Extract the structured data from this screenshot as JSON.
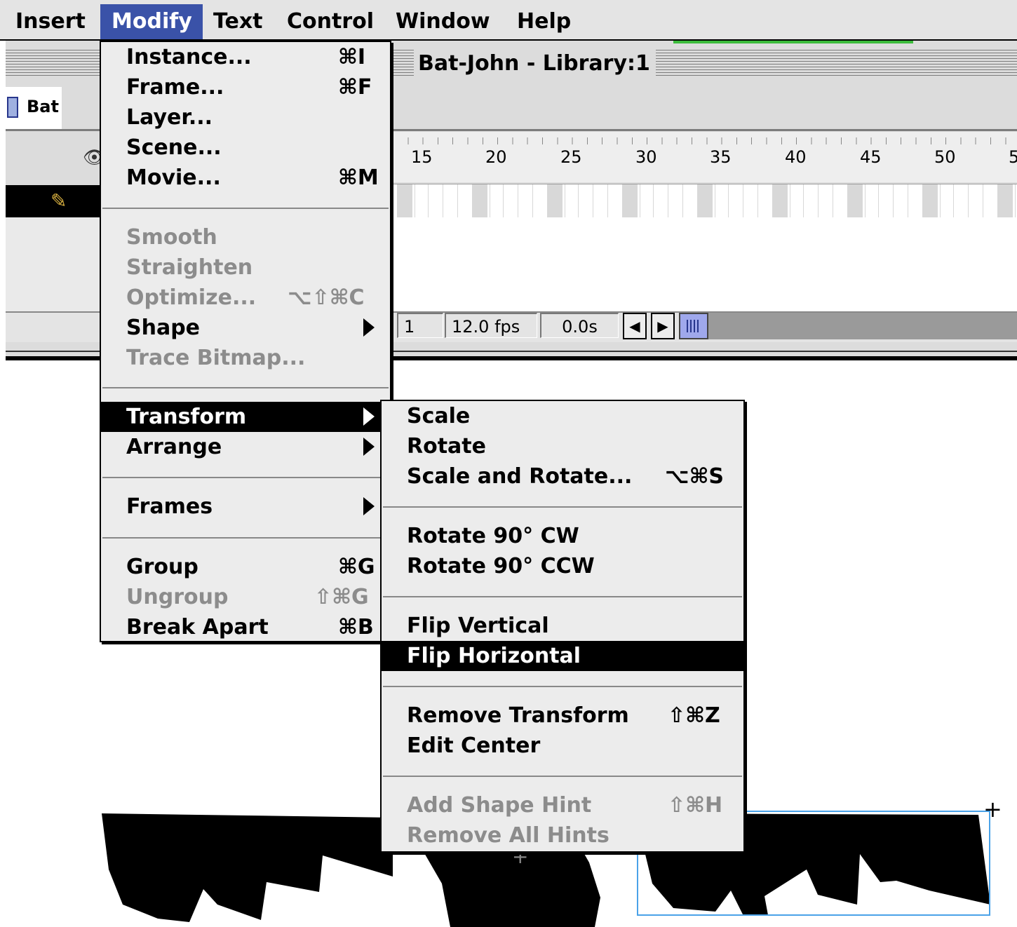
{
  "menubar": {
    "items": [
      "Insert",
      "Modify",
      "Text",
      "Control",
      "Window",
      "Help"
    ],
    "active": "Modify"
  },
  "timeline": {
    "title": "Bat-John - Library:1",
    "tab_label": "Bat",
    "ruler_labels": [
      "15",
      "20",
      "25",
      "30",
      "35",
      "40",
      "45",
      "50",
      "5"
    ],
    "current_frame": "1",
    "fps": "12.0 fps",
    "elapsed": "0.0s"
  },
  "modify_menu": {
    "items": [
      {
        "label": "Instance...",
        "shortcut": "⌘I",
        "enabled": true
      },
      {
        "label": "Frame...",
        "shortcut": "⌘F",
        "enabled": true
      },
      {
        "label": "Layer...",
        "shortcut": "",
        "enabled": true
      },
      {
        "label": "Scene...",
        "shortcut": "",
        "enabled": true
      },
      {
        "label": "Movie...",
        "shortcut": "⌘M",
        "enabled": true
      },
      {
        "label": "Smooth",
        "shortcut": "",
        "enabled": false
      },
      {
        "label": "Straighten",
        "shortcut": "",
        "enabled": false
      },
      {
        "label": "Optimize...",
        "shortcut": "⌥⇧⌘C",
        "enabled": false
      },
      {
        "label": "Shape",
        "shortcut": "",
        "enabled": true,
        "submenu": true
      },
      {
        "label": "Trace Bitmap...",
        "shortcut": "",
        "enabled": false
      },
      {
        "label": "Transform",
        "shortcut": "",
        "enabled": true,
        "submenu": true,
        "highlighted": true
      },
      {
        "label": "Arrange",
        "shortcut": "",
        "enabled": true,
        "submenu": true
      },
      {
        "label": "Frames",
        "shortcut": "",
        "enabled": true,
        "submenu": true
      },
      {
        "label": "Group",
        "shortcut": "⌘G",
        "enabled": true
      },
      {
        "label": "Ungroup",
        "shortcut": "⇧⌘G",
        "enabled": false
      },
      {
        "label": "Break Apart",
        "shortcut": "⌘B",
        "enabled": true
      }
    ]
  },
  "transform_menu": {
    "items": [
      {
        "label": "Scale",
        "shortcut": "",
        "enabled": true
      },
      {
        "label": "Rotate",
        "shortcut": "",
        "enabled": true
      },
      {
        "label": "Scale and Rotate...",
        "shortcut": "⌥⌘S",
        "enabled": true
      },
      {
        "label": "Rotate 90° CW",
        "shortcut": "",
        "enabled": true
      },
      {
        "label": "Rotate 90° CCW",
        "shortcut": "",
        "enabled": true
      },
      {
        "label": "Flip Vertical",
        "shortcut": "",
        "enabled": true
      },
      {
        "label": "Flip Horizontal",
        "shortcut": "",
        "enabled": true,
        "highlighted": true
      },
      {
        "label": "Remove Transform",
        "shortcut": "⇧⌘Z",
        "enabled": true
      },
      {
        "label": "Edit Center",
        "shortcut": "",
        "enabled": true
      },
      {
        "label": "Add Shape Hint",
        "shortcut": "⇧⌘H",
        "enabled": false
      },
      {
        "label": "Remove All Hints",
        "shortcut": "",
        "enabled": false
      }
    ]
  },
  "icons": {
    "layer_edit": "pencil-icon",
    "layer_visibility": "eye-icon",
    "scroll_left": "left-arrow-icon",
    "scroll_right": "right-arrow-icon",
    "submenu": "submenu-arrow-icon",
    "registration": "crosshair-icon"
  },
  "colors": {
    "menubar_active": "#3a52a8",
    "selection_outline": "#4aa2e8",
    "scroll_thumb": "#9fa8ec"
  }
}
